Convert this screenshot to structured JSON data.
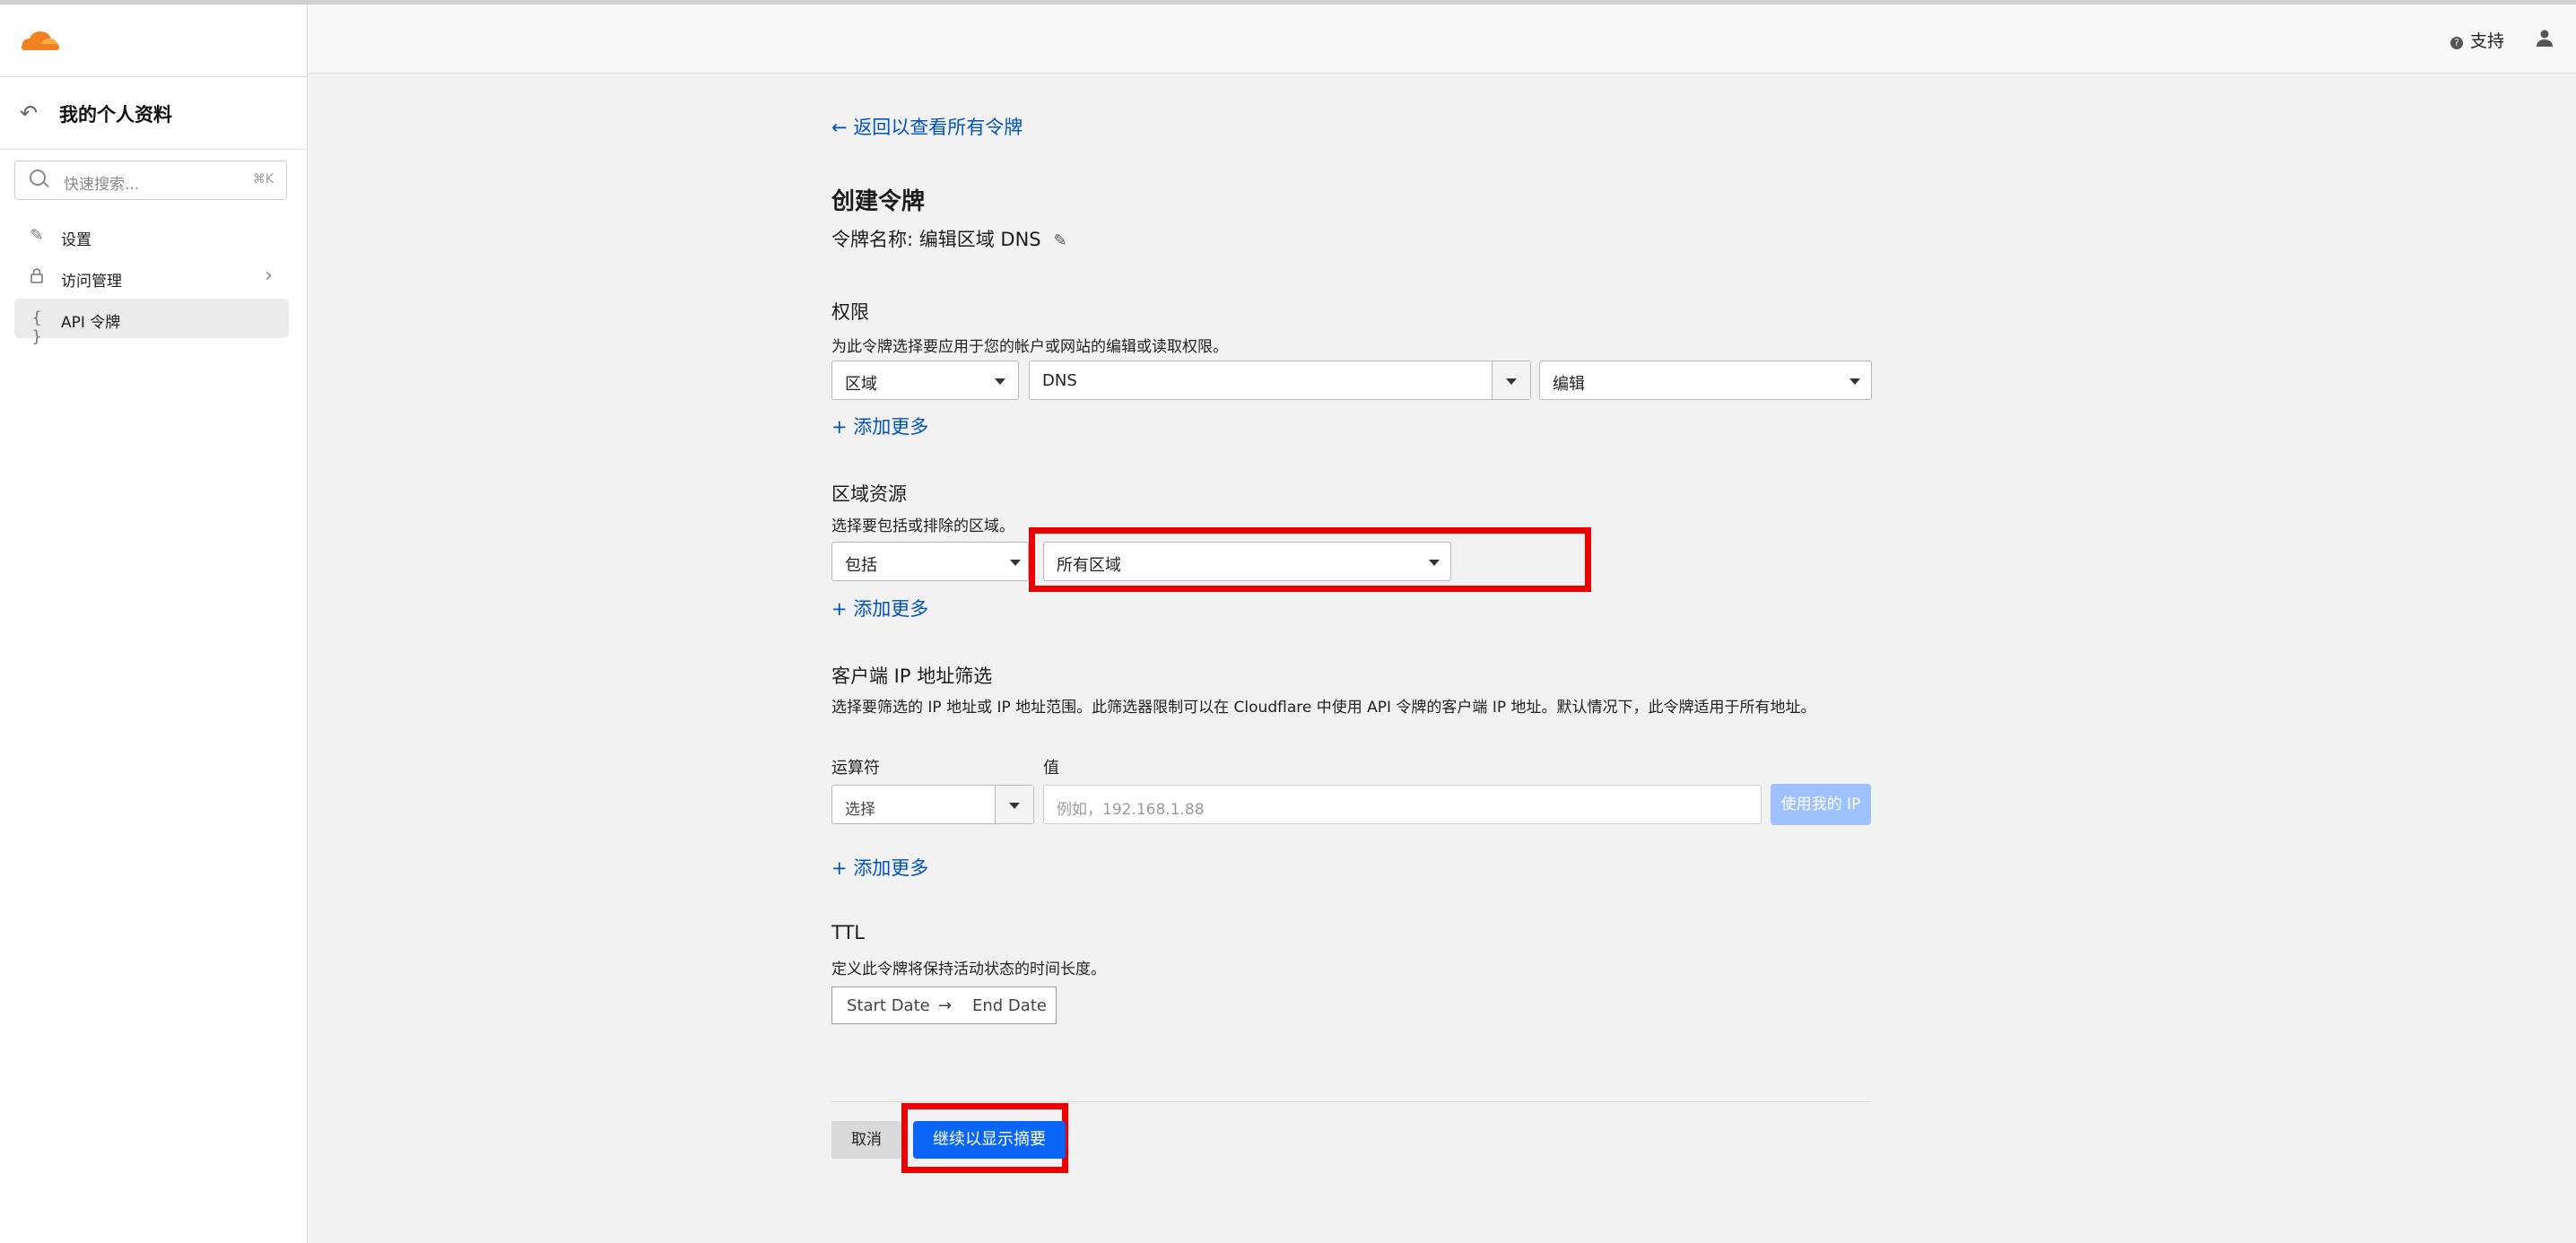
{
  "sidebar": {
    "title": "我的个人资料",
    "search": {
      "placeholder": "快速搜索...",
      "shortcut": "⌘K"
    },
    "items": [
      {
        "label": "设置",
        "icon": "pencil-icon"
      },
      {
        "label": "访问管理",
        "icon": "lock-icon"
      },
      {
        "label": "API 令牌",
        "icon": "braces-icon",
        "active": true
      }
    ]
  },
  "header": {
    "support_label": "支持"
  },
  "main": {
    "back_link": "← 返回以查看所有令牌",
    "title": "创建令牌",
    "token_name": "令牌名称: 编辑区域 DNS",
    "permissions": {
      "title": "权限",
      "description": "为此令牌选择要应用于您的帐户或网站的编辑或读取权限。",
      "scope_value": "区域",
      "resource_value": "DNS",
      "access_value": "编辑",
      "add_more": "+ 添加更多"
    },
    "zone_resources": {
      "title": "区域资源",
      "description": "选择要包括或排除的区域。",
      "mode_value": "包括",
      "zone_value": "所有区域",
      "add_more": "+ 添加更多"
    },
    "ip_filter": {
      "title": "客户端 IP 地址筛选",
      "description": "选择要筛选的 IP 地址或 IP 地址范围。此筛选器限制可以在 Cloudflare 中使用 API 令牌的客户端 IP 地址。默认情况下，此令牌适用于所有地址。",
      "operator_label": "运算符",
      "value_label": "值",
      "operator_placeholder": "选择",
      "value_placeholder": "例如，192.168.1.88",
      "use_my_ip": "使用我的 IP",
      "add_more": "+ 添加更多"
    },
    "ttl": {
      "title": "TTL",
      "description": "定义此令牌将保持活动状态的时间长度。",
      "start_date": "Start Date",
      "arrow": "→",
      "end_date": "End Date"
    },
    "cancel_label": "取消",
    "continue_label": "继续以显示摘要"
  },
  "colors": {
    "accent": "#0051c3",
    "primary_button": "#0a64f5",
    "highlight": "#ee0000",
    "brand": "#f38020"
  }
}
